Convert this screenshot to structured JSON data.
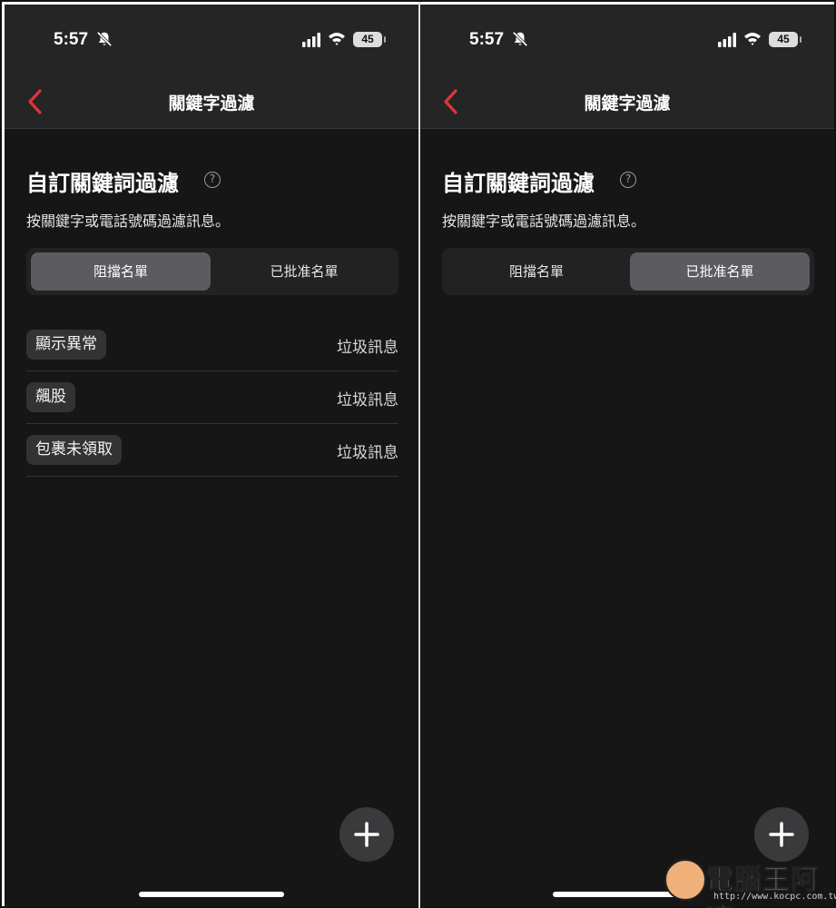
{
  "status_bar": {
    "time": "5:57",
    "battery": "45"
  },
  "nav": {
    "title": "關鍵字過濾"
  },
  "section": {
    "title": "自訂關鍵詞過濾",
    "description": "按關鍵字或電話號碼過濾訊息。",
    "help_glyph": "?"
  },
  "segments": {
    "blocklist": "阻擋名單",
    "allowlist": "已批准名單"
  },
  "screens": [
    {
      "selected_segment": "阻擋名單"
    },
    {
      "selected_segment": "已批准名單"
    }
  ],
  "blocklist_items": [
    {
      "keyword": "顯示異常",
      "category": "垃圾訊息"
    },
    {
      "keyword": "飆股",
      "category": "垃圾訊息"
    },
    {
      "keyword": "包裹未領取",
      "category": "垃圾訊息"
    }
  ],
  "watermark": {
    "text": "電腦王阿達",
    "url": "http://www.kocpc.com.tw"
  },
  "colors": {
    "back_accent": "#e0343b",
    "background": "#161616",
    "bar": "#252525"
  }
}
